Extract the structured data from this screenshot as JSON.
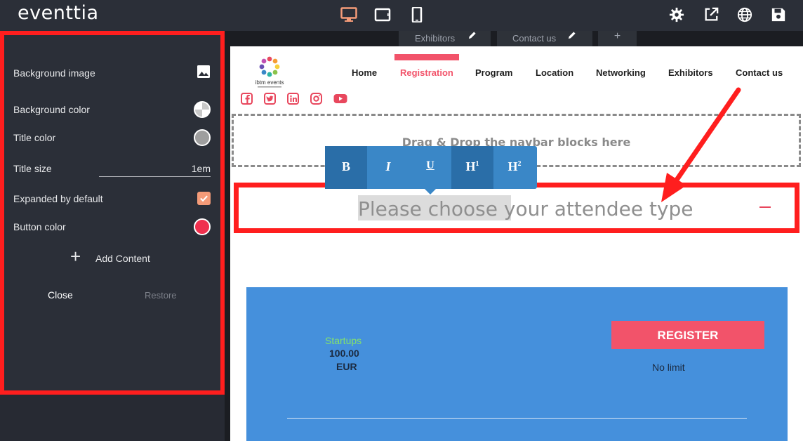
{
  "app": {
    "logo": "eventtia"
  },
  "devices": {
    "desktop": "desktop-icon",
    "tablet": "tablet-icon",
    "mobile": "mobile-icon",
    "active": "desktop"
  },
  "toolbar": {
    "settings": "gear-icon",
    "preview": "external-link-icon",
    "language": "globe-icon",
    "save": "save-icon"
  },
  "panel": {
    "background_image": "Background image",
    "background_color": "Background color",
    "title_color": "Title color",
    "title_size": "Title size",
    "title_size_value": "1em",
    "expanded_by_default": "Expanded by default",
    "expanded_checked": true,
    "button_color": "Button color",
    "title_color_hex": "#9e9e9e",
    "button_color_hex": "#f0304e",
    "add_content": "Add Content",
    "close": "Close",
    "restore": "Restore"
  },
  "tabs": [
    "Exhibitors",
    "Contact us",
    "+"
  ],
  "site": {
    "nav": [
      "Home",
      "Registration",
      "Program",
      "Location",
      "Networking",
      "Exhibitors",
      "Contact us"
    ],
    "active_nav": "Registration",
    "accent": "#f2536a",
    "social": [
      "facebook-icon",
      "twitter-icon",
      "linkedin-icon",
      "instagram-icon",
      "youtube-icon"
    ]
  },
  "dropzone": {
    "text": "Drag & Drop the navbar blocks here"
  },
  "format_toolbar": {
    "bold": "B",
    "italic": "I",
    "underline": "U",
    "h1": "H",
    "h1_sup": "1",
    "h2": "H",
    "h2_sup": "2"
  },
  "accordion": {
    "title": "Please choose your attendee type"
  },
  "ticket": {
    "name": "Startups",
    "price": "100.00",
    "currency": "EUR",
    "register": "REGISTER",
    "limit": "No limit"
  }
}
